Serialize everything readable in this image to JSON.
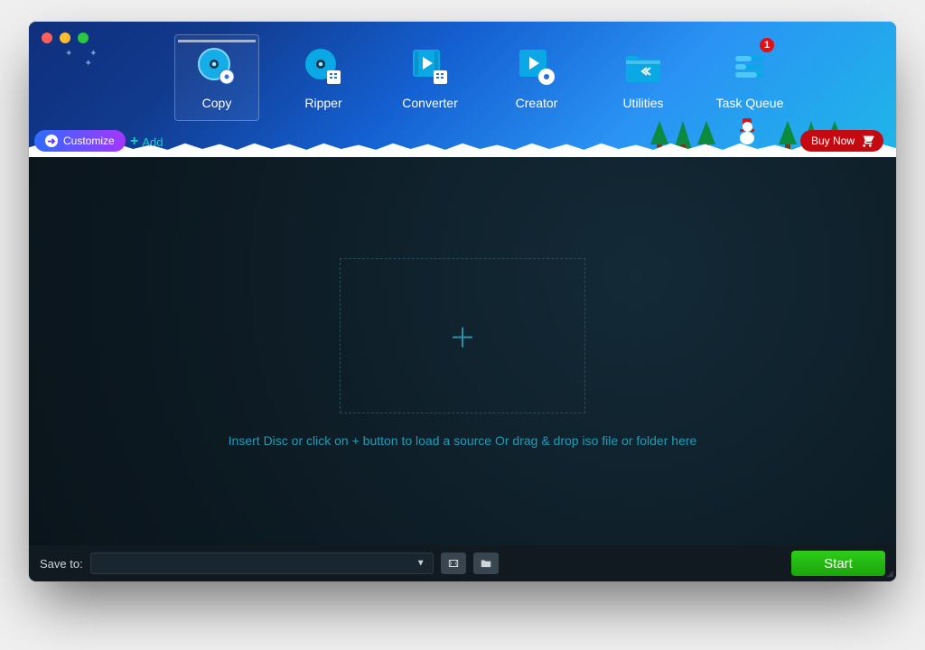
{
  "nav": {
    "items": [
      {
        "label": "Copy",
        "active": true
      },
      {
        "label": "Ripper"
      },
      {
        "label": "Converter"
      },
      {
        "label": "Creator"
      },
      {
        "label": "Utilities"
      },
      {
        "label": "Task Queue",
        "badge": "1"
      }
    ]
  },
  "toolbar": {
    "customize_label": "Customize",
    "add_label": "Add",
    "buy_label": "Buy Now"
  },
  "main": {
    "hint": "Insert Disc or click on + button to load a source Or drag & drop iso file or folder here"
  },
  "footer": {
    "save_to_label": "Save to:",
    "start_label": "Start"
  }
}
